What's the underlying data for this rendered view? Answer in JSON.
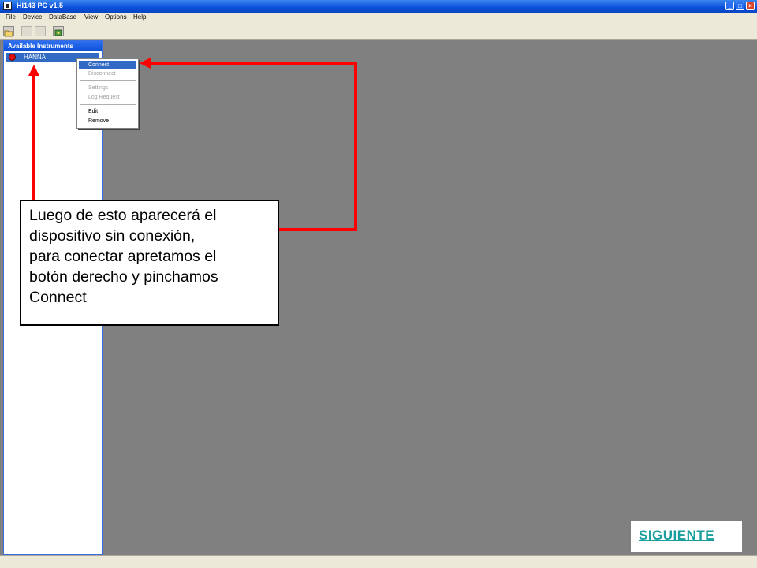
{
  "window": {
    "title": "HI143 PC v1.5"
  },
  "menubar": {
    "items": [
      "File",
      "Device",
      "DataBase",
      "View",
      "Options",
      "Help"
    ]
  },
  "toolbar": {
    "icons": [
      "open-folder-icon",
      "disabled-tool-icon",
      "disabled-tool-icon",
      "connect-device-icon"
    ]
  },
  "panel": {
    "title": "Available Instruments",
    "instruments": [
      {
        "label": "HANNA",
        "status_color": "#e01010"
      }
    ]
  },
  "context_menu": {
    "items": [
      {
        "label": "Connect",
        "enabled": true,
        "highlighted": true
      },
      {
        "label": "Disconnect",
        "enabled": false
      },
      {
        "label": "Settings",
        "enabled": false
      },
      {
        "label": "Log Request",
        "enabled": false
      },
      {
        "label": "Edit",
        "enabled": true
      },
      {
        "label": "Remove",
        "enabled": true
      }
    ]
  },
  "callout": {
    "lines": [
      "Luego de esto aparecerá el",
      "dispositivo sin conexión,",
      "para conectar apretamos el",
      "botón derecho y pinchamos",
      "Connect"
    ]
  },
  "next_button": {
    "label": "SIGUIENTE"
  },
  "colors": {
    "arrow": "#ff0000",
    "title_bar": "#0a4fd8",
    "highlight": "#316ac5",
    "next_text": "#1a9e9e"
  }
}
